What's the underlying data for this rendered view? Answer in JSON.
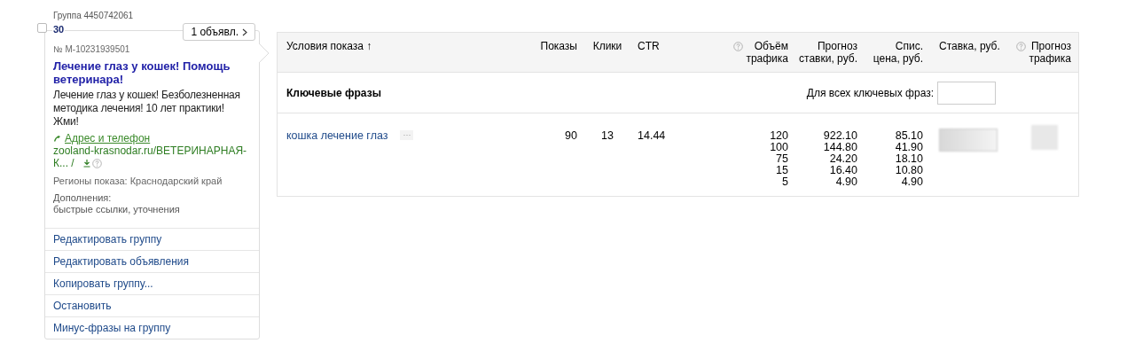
{
  "group": {
    "label": "Группа 4450742061",
    "checked": false,
    "count": "30",
    "ads_button": "1 объявл.",
    "ad": {
      "number": "№ M-10231939501",
      "title": "Лечение глаз у кошек! Помощь ветеринара!",
      "text": "Лечение глаз у кошек! Безболезненная методика лечения! 10 лет практики! Жми!",
      "contact_link": "Адрес и телефон",
      "url": "zooland-krasnodar.ru/ВЕТЕРИНАРНАЯ-К... /",
      "regions": "Регионы показа: Краснодарский край",
      "additions_label": "Дополнения:",
      "additions": "быстрые ссылки, уточнения"
    },
    "menu": [
      "Редактировать группу",
      "Редактировать объявления",
      "Копировать группу...",
      "Остановить",
      "Минус-фразы на группу"
    ]
  },
  "table": {
    "columns": [
      {
        "lines": [
          "Условия показа"
        ],
        "sort_arrow": "↑",
        "help": false
      },
      {
        "lines": [
          "Показы"
        ],
        "help": false
      },
      {
        "lines": [
          "Клики"
        ],
        "help": false
      },
      {
        "lines": [
          "CTR"
        ],
        "help": false
      },
      {
        "lines": [
          "Объём",
          "трафика"
        ],
        "help": true
      },
      {
        "lines": [
          "Прогноз",
          "ставки, руб."
        ],
        "help": false
      },
      {
        "lines": [
          "Спис.",
          "цена, руб."
        ],
        "help": false
      },
      {
        "lines": [
          "Ставка, руб."
        ],
        "help": false
      },
      {
        "lines": [
          "Прогноз",
          "трафика"
        ],
        "help": true
      }
    ],
    "section": {
      "title": "Ключевые фразы",
      "all_label": "Для всех ключевых фраз:"
    },
    "rows": [
      {
        "phrase": "кошка лечение глаз",
        "more": "···",
        "shows": "90",
        "clicks": "13",
        "ctr": "14.44",
        "traffic": [
          "120",
          "100",
          "75",
          "15",
          "5"
        ],
        "forecast": [
          "922.10",
          "144.80",
          "24.20",
          "16.40",
          "4.90"
        ],
        "price": [
          "85.10",
          "41.90",
          "18.10",
          "10.80",
          "4.90"
        ]
      }
    ]
  }
}
